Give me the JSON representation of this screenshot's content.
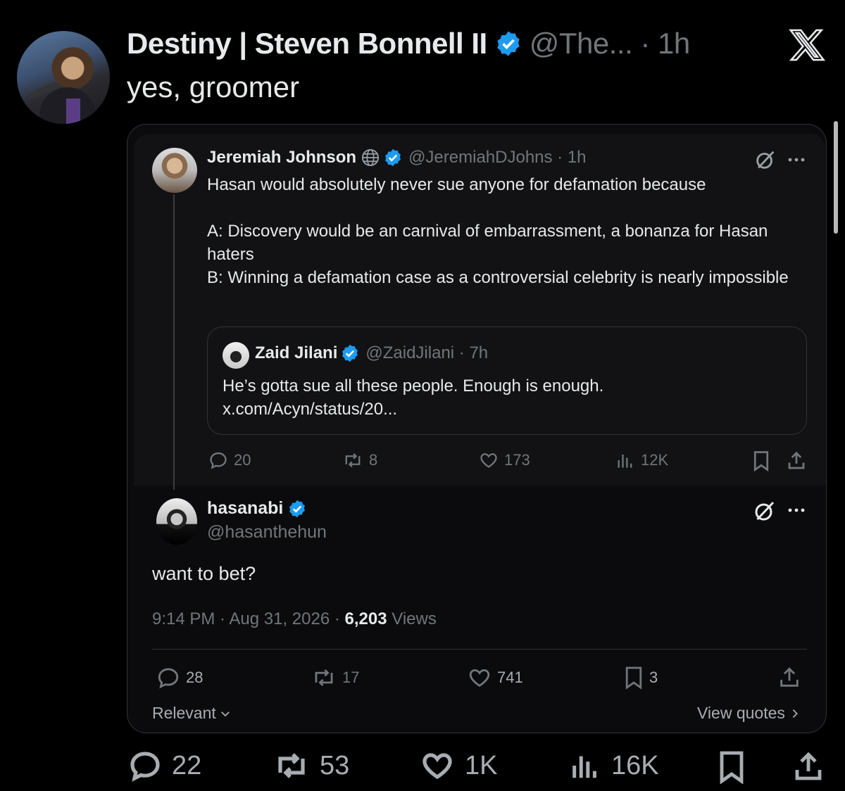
{
  "main_tweet": {
    "display_name": "Destiny | Steven Bonnell II",
    "handle_time": "@The... · 1h",
    "text": "yes, groomer"
  },
  "quoted_tweet": {
    "display_name": "Jeremiah Johnson",
    "handle_time": "@JeremiahDJohns · 1h",
    "line1": "Hasan would absolutely never sue anyone for defamation because",
    "line2": "A: Discovery would be an carnival of embarrassment, a bonanza for Hasan haters",
    "line3": "B: Winning a defamation case as a controversial celebrity is nearly impossible",
    "nested_quote": {
      "display_name": "Zaid Jilani",
      "handle_time": "@ZaidJilani · 7h",
      "line1": "He’s gotta sue all these people. Enough is enough.",
      "link": "x.com/Acyn/status/20..."
    },
    "actions": {
      "replies": "20",
      "reposts": "8",
      "likes": "173",
      "views": "12K"
    }
  },
  "reply_tweet": {
    "display_name": "hasanabi",
    "handle": "@hasanthehun",
    "text": "want to bet?",
    "meta_time": "9:14 PM · Aug 31, 2026 · ",
    "views_count": "6,203",
    "views_label": " Views",
    "actions": {
      "replies": "28",
      "reposts": "17",
      "likes": "741",
      "bookmarks": "3"
    },
    "sort_label": "Relevant",
    "view_quotes": "View quotes"
  },
  "bottom_actions": {
    "replies": "22",
    "reposts": "53",
    "likes": "1K",
    "views": "16K"
  },
  "colors": {
    "background": "#000000",
    "text": "#e7e9ea",
    "muted": "#71767b",
    "verified": "#1d9bf0"
  }
}
